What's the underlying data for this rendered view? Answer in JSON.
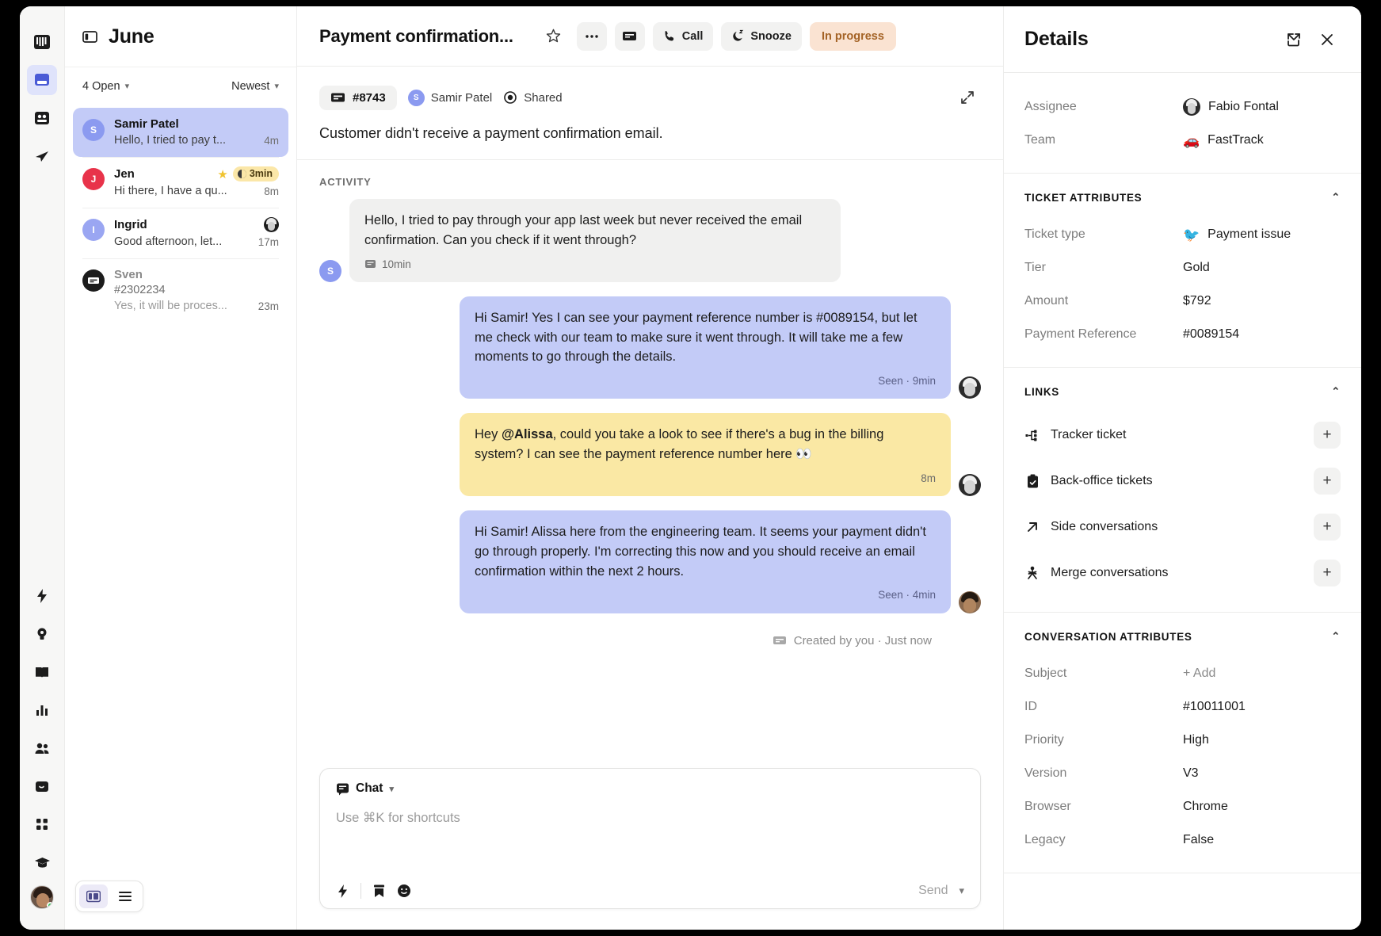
{
  "rail": {
    "top_icons": [
      {
        "name": "logo-icon",
        "glyph": "logo"
      },
      {
        "name": "inbox-icon",
        "glyph": "inbox",
        "active": true
      },
      {
        "name": "contacts-icon",
        "glyph": "contacts"
      },
      {
        "name": "send-icon",
        "glyph": "send"
      }
    ],
    "bottom_icons": [
      {
        "name": "automation-icon",
        "glyph": "bolt"
      },
      {
        "name": "ideas-icon",
        "glyph": "bulb"
      },
      {
        "name": "knowledge-icon",
        "glyph": "book"
      },
      {
        "name": "reports-icon",
        "glyph": "chart"
      },
      {
        "name": "team-icon",
        "glyph": "people"
      },
      {
        "name": "messenger-icon",
        "glyph": "messenger"
      },
      {
        "name": "apps-icon",
        "glyph": "grid"
      },
      {
        "name": "academy-icon",
        "glyph": "cap"
      }
    ]
  },
  "list": {
    "title": "June",
    "filter_status": "4 Open",
    "filter_sort": "Newest",
    "conversations": [
      {
        "name": "Samir Patel",
        "initial": "S",
        "avatar_color": "#8b9af0",
        "preview": "Hello, I tried to pay t...",
        "time": "4m",
        "selected": true,
        "starred": false,
        "sla": null
      },
      {
        "name": "Jen",
        "initial": "J",
        "avatar_color": "#e8334a",
        "preview": "Hi there, I have a qu...",
        "time": "8m",
        "selected": false,
        "starred": true,
        "sla": "3min"
      },
      {
        "name": "Ingrid",
        "initial": "I",
        "avatar_color": "#9aa6f2",
        "preview": "Good afternoon, let...",
        "time": "17m",
        "selected": false,
        "starred": false,
        "sla": null,
        "has_agent_avatar": true
      },
      {
        "name": "Sven",
        "ticket_id": "#2302234",
        "preview": "Yes, it will be proces...",
        "time": "23m",
        "selected": false,
        "is_ticket": true
      }
    ]
  },
  "main": {
    "title": "Payment confirmation...",
    "header_buttons": [
      {
        "name": "star-button",
        "label": "",
        "icon": "star"
      },
      {
        "name": "more-button",
        "label": "",
        "icon": "dots"
      },
      {
        "name": "ticket-button",
        "label": "",
        "icon": "ticket"
      },
      {
        "name": "call-button",
        "label": "Call",
        "icon": "phone"
      },
      {
        "name": "snooze-button",
        "label": "Snooze",
        "icon": "moon"
      }
    ],
    "call_label": "Call",
    "snooze_label": "Snooze",
    "status_label": "In progress",
    "ticket_number": "#8743",
    "customer_name": "Samir Patel",
    "customer_initial": "S",
    "visibility": "Shared",
    "subject": "Customer didn't receive a payment confirmation email.",
    "activity_label": "ACTIVITY",
    "messages": [
      {
        "direction": "in",
        "kind": "inbound",
        "text": "Hello, I tried to pay through your app last week but never received the email confirmation. Can you check if it went through?",
        "meta": "10min",
        "has_channel_icon": true,
        "avatar_initial": "S",
        "avatar_color": "#8b9af0"
      },
      {
        "direction": "out",
        "kind": "outbound",
        "text": "Hi Samir! Yes I can see your payment reference number is #0089154, but let me check with our team to make sure it went through. It will take me a few moments to go through the details.",
        "meta": "Seen · 9min",
        "avatar_style": "dark"
      },
      {
        "direction": "out",
        "kind": "note",
        "text_prefix": "Hey ",
        "mention": "@Alissa",
        "text_suffix": ", could you take a look to see if there's a bug in the billing system? I can see the payment reference number here 👀",
        "meta": "8m",
        "avatar_style": "dark"
      },
      {
        "direction": "out",
        "kind": "outbound",
        "text": "Hi Samir! Alissa here from the engineering team. It seems your payment didn't go through properly. I'm correcting this now and you should receive an email confirmation within the next 2 hours.",
        "meta": "Seen · 4min",
        "avatar_style": "brown"
      }
    ],
    "created_note": "Created by you · Just now"
  },
  "composer": {
    "mode_label": "Chat",
    "placeholder": "Use ⌘K for shortcuts",
    "send_label": "Send",
    "tools": [
      {
        "name": "shortcuts-icon"
      },
      {
        "name": "saved-reply-icon"
      },
      {
        "name": "emoji-icon"
      }
    ]
  },
  "layout_toggle": {
    "left_name": "split-view-button",
    "right_name": "list-view-button"
  },
  "details": {
    "title": "Details",
    "open_label": "",
    "close_label": "",
    "top_rows": [
      {
        "label": "Assignee",
        "value": "Fabio Fontal",
        "icon": "avatar"
      },
      {
        "label": "Team",
        "value": "FastTrack",
        "icon": "🚗"
      }
    ],
    "ticket_attributes": {
      "heading": "TICKET ATTRIBUTES",
      "rows": [
        {
          "label": "Ticket type",
          "value": "Payment issue",
          "icon": "🐦"
        },
        {
          "label": "Tier",
          "value": "Gold"
        },
        {
          "label": "Amount",
          "value": "$792"
        },
        {
          "label": "Payment Reference",
          "value": "#0089154"
        }
      ]
    },
    "links": {
      "heading": "LINKS",
      "items": [
        {
          "label": "Tracker ticket",
          "icon": "tracker",
          "action": "+"
        },
        {
          "label": "Back-office tickets",
          "icon": "clipboard",
          "action": "+"
        },
        {
          "label": "Side conversations",
          "icon": "arrow",
          "action": "+"
        },
        {
          "label": "Merge conversations",
          "icon": "merge",
          "action": "+"
        }
      ]
    },
    "conversation_attributes": {
      "heading": "CONVERSATION ATTRIBUTES",
      "rows": [
        {
          "label": "Subject",
          "value": "+ Add",
          "dim": true
        },
        {
          "label": "ID",
          "value": "#10011001"
        },
        {
          "label": "Priority",
          "value": "High"
        },
        {
          "label": "Version",
          "value": "V3"
        },
        {
          "label": "Browser",
          "value": "Chrome"
        },
        {
          "label": "Legacy",
          "value": "False"
        }
      ]
    }
  },
  "colors": {
    "accent": "#5a6ce0",
    "selected_conv": "#c3cbf7",
    "outbound_bubble": "#c3cbf7",
    "note_bubble": "#fae8a4",
    "inbound_bubble": "#f0f0ef",
    "status_pill_bg": "#fae3d2",
    "status_pill_fg": "#a46326"
  }
}
